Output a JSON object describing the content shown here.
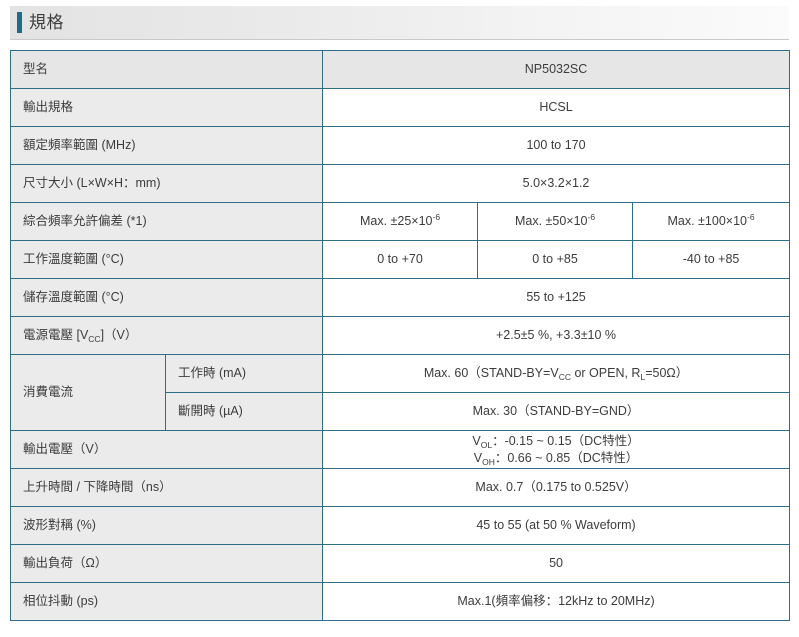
{
  "header": {
    "title": "規格",
    "accent_color": "#1f6b8c"
  },
  "table": {
    "rows": [
      {
        "label": "型名",
        "value": "NP5032SC"
      },
      {
        "label": "輸出規格",
        "value": "HCSL"
      },
      {
        "label": "額定頻率範圍 (MHz)",
        "value": "100 to 170"
      },
      {
        "label": "尺寸大小 (L×W×H：mm)",
        "value": "5.0×3.2×1.2"
      },
      {
        "label": "綜合頻率允許偏差 (*1)",
        "values": [
          "Max. ±25×10",
          "Max. ±50×10",
          "Max. ±100×10"
        ],
        "exponent": "-6"
      },
      {
        "label": "工作溫度範圍 (°C)",
        "values": [
          "0 to +70",
          "0 to +85",
          "-40 to +85"
        ]
      },
      {
        "label": "儲存溫度範圍 (°C)",
        "value": "55 to +125"
      },
      {
        "label_pre": "電源電壓 [V",
        "label_sub": "CC",
        "label_post": "]（V）",
        "value": "+2.5±5 %, +3.3±10 %"
      },
      {
        "label": "消費電流",
        "sub_label": "工作時 (mA)",
        "value_parts": [
          "Max. 60（STAND-BY=V",
          "CC",
          " or OPEN, R",
          "L",
          "=50Ω）"
        ]
      },
      {
        "sub_label": "斷開時 (µA)",
        "value": "Max. 30（STAND-BY=GND）"
      },
      {
        "label": "輸出電壓（V）",
        "line1_pre": "V",
        "line1_sub": "OL",
        "line1_post": "：-0.15 ~ 0.15（DC特性）",
        "line2_pre": "V",
        "line2_sub": "OH",
        "line2_post": "：0.66 ~ 0.85（DC特性）"
      },
      {
        "label": "上升時間 / 下降時間（ns）",
        "value": "Max. 0.7（0.175 to 0.525V）"
      },
      {
        "label": "波形對稱 (%)",
        "value": "45 to 55 (at 50 % Waveform)"
      },
      {
        "label": "輸出負荷（Ω）",
        "value": "50"
      },
      {
        "label": "相位抖動 (ps)",
        "value": "Max.1(頻率偏移：12kHz to 20MHz)"
      }
    ]
  }
}
